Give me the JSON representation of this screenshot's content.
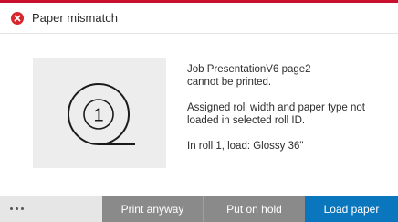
{
  "header": {
    "title": "Paper mismatch",
    "icon": "error-circle-icon",
    "accent_color": "#c8102e",
    "error_color": "#d8262c"
  },
  "illustration": {
    "roll_number": "1",
    "icon": "paper-roll-icon"
  },
  "message": {
    "line1": "Job PresentationV6 page2",
    "line2": "cannot be printed.",
    "line3": "Assigned roll width and paper type not",
    "line4": "loaded in selected roll ID.",
    "line5": "In roll 1, load: Glossy 36\""
  },
  "footer": {
    "more_icon": "more-dots-icon",
    "print_anyway_label": "Print anyway",
    "put_on_hold_label": "Put on hold",
    "load_paper_label": "Load paper",
    "primary_color": "#0a76bd",
    "secondary_color": "#8a8a8a"
  }
}
